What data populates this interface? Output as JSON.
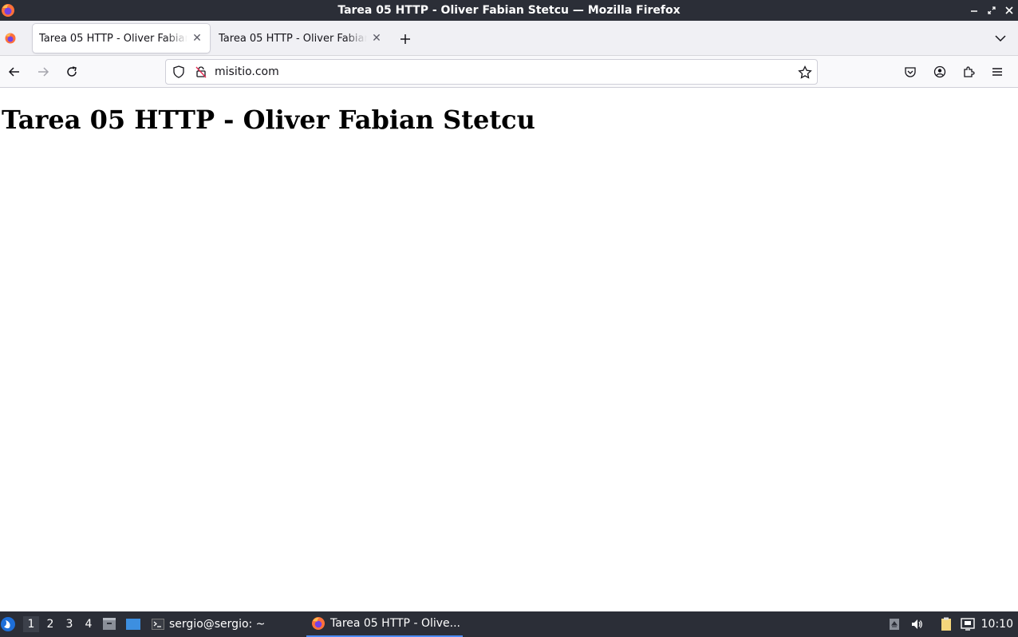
{
  "window": {
    "title": "Tarea 05 HTTP - Oliver Fabian Stetcu — Mozilla Firefox"
  },
  "tabs": [
    {
      "label": "Tarea 05 HTTP - Oliver Fabian Stetcu",
      "active": true
    },
    {
      "label": "Tarea 05 HTTP - Oliver Fabian Stetcu",
      "active": false
    }
  ],
  "navbar": {
    "url": "misitio.com"
  },
  "page": {
    "heading": "Tarea 05 HTTP - Oliver Fabian Stetcu"
  },
  "taskbar": {
    "workspaces": [
      "1",
      "2",
      "3",
      "4"
    ],
    "active_workspace": "1",
    "tasks": [
      {
        "label": "sergio@sergio: ~",
        "icon": "terminal-icon",
        "active": false
      },
      {
        "label": "Tarea 05 HTTP - Olive...",
        "icon": "firefox-icon",
        "active": true
      }
    ],
    "clock": "10:10"
  },
  "colors": {
    "titlebar": "#2b2e37",
    "tabstrip": "#f0f0f4",
    "accent": "#4c8bf5"
  }
}
